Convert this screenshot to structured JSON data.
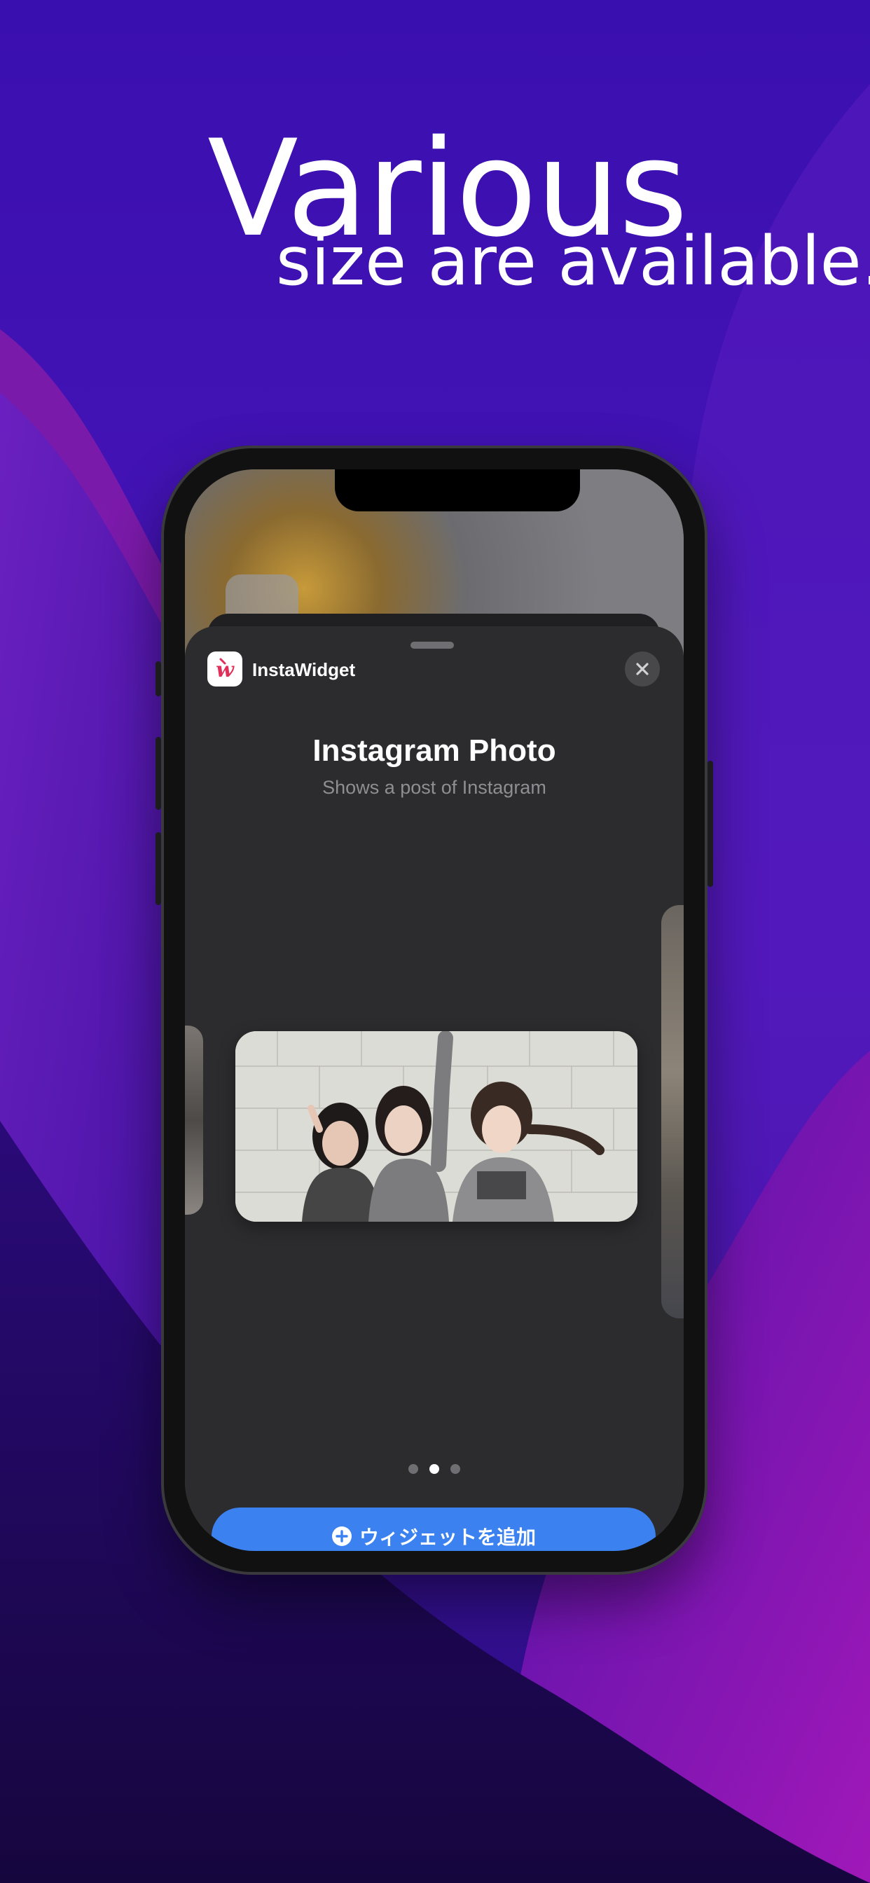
{
  "headline": {
    "line1": "Various",
    "line2": "size are available."
  },
  "sheet": {
    "app_name": "InstaWidget",
    "widget_title": "Instagram Photo",
    "widget_subtitle": "Shows a post of Instagram",
    "page_indicator": {
      "count": 3,
      "active_index": 1
    },
    "add_button_label": "ウィジェットを追加"
  },
  "colors": {
    "accent": "#3b82f0",
    "sheet_bg": "#2c2c2e",
    "background_primary": "#3b10b0",
    "background_secondary": "#8a16b0"
  },
  "icons": [
    "app-logo-icon",
    "close-icon",
    "plus-circle-icon"
  ]
}
